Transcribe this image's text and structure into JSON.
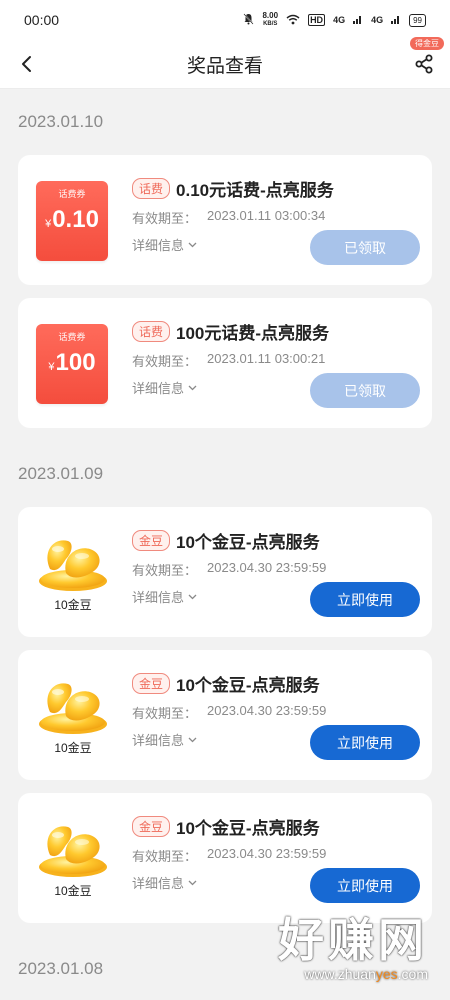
{
  "status_bar": {
    "time": "00:00",
    "speed_value": "8.00",
    "speed_unit": "KB/S",
    "hd": "HD",
    "net1": "4G",
    "net2": "4G",
    "battery": "99"
  },
  "header": {
    "title": "奖品查看",
    "share_badge": "得金豆"
  },
  "groups": [
    {
      "date": "2023.01.10",
      "items": [
        {
          "kind": "coupon",
          "coupon_label": "话费券",
          "coupon_currency": "¥",
          "coupon_value": "0.10",
          "tag": "话费",
          "title": "0.10元话费-点亮服务",
          "expiry_label": "有效期至：",
          "expiry": "2023.01.11 03:00:34",
          "detail": "详细信息",
          "action": "已领取"
        },
        {
          "kind": "coupon",
          "coupon_label": "话费券",
          "coupon_currency": "¥",
          "coupon_value": "100",
          "tag": "话费",
          "title": "100元话费-点亮服务",
          "expiry_label": "有效期至：",
          "expiry": "2023.01.11 03:00:21",
          "detail": "详细信息",
          "action": "已领取"
        }
      ]
    },
    {
      "date": "2023.01.09",
      "items": [
        {
          "kind": "bean",
          "bean_label": "10金豆",
          "tag": "金豆",
          "title": "10个金豆-点亮服务",
          "expiry_label": "有效期至：",
          "expiry": "2023.04.30 23:59:59",
          "detail": "详细信息",
          "action": "立即使用"
        },
        {
          "kind": "bean",
          "bean_label": "10金豆",
          "tag": "金豆",
          "title": "10个金豆-点亮服务",
          "expiry_label": "有效期至：",
          "expiry": "2023.04.30 23:59:59",
          "detail": "详细信息",
          "action": "立即使用"
        },
        {
          "kind": "bean",
          "bean_label": "10金豆",
          "tag": "金豆",
          "title": "10个金豆-点亮服务",
          "expiry_label": "有效期至：",
          "expiry": "2023.04.30 23:59:59",
          "detail": "详细信息",
          "action": "立即使用"
        }
      ]
    },
    {
      "date": "2023.01.08",
      "items": []
    }
  ],
  "watermark": {
    "main": "好赚网",
    "url_prefix": "www.zhuan",
    "url_highlight": "yes",
    "url_suffix": ".com"
  },
  "colors": {
    "accent_blue": "#1769d3",
    "claimed_blue": "#a8c3ea",
    "tag_red": "#ef6a5a",
    "coupon_red": "#f44d3d"
  }
}
